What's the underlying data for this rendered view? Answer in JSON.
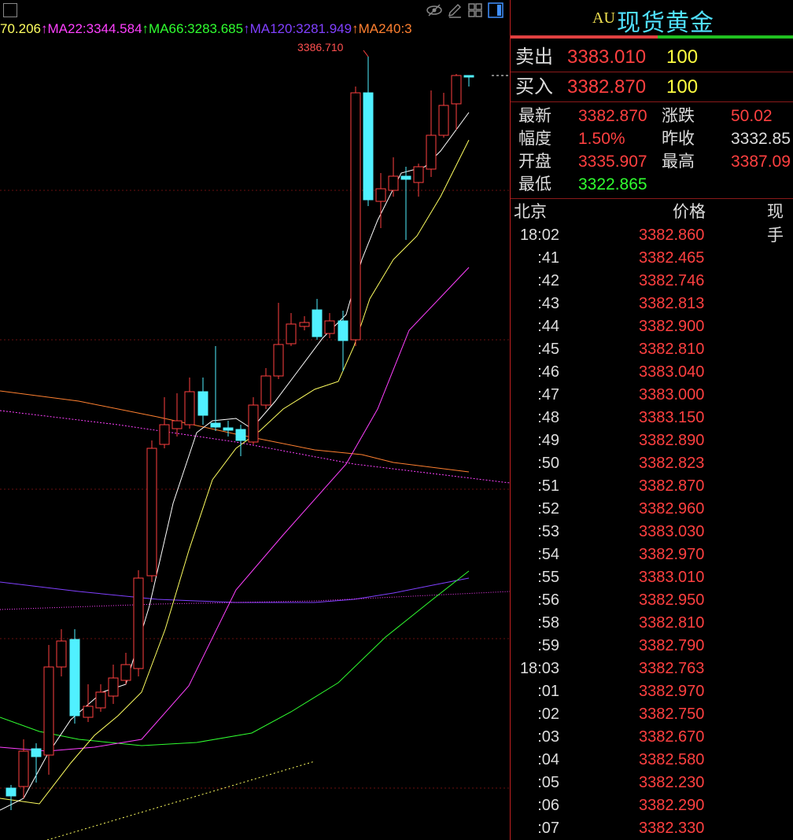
{
  "chart": {
    "high_marker": "3386.710",
    "ma_legend": [
      {
        "text": "70.206",
        "color": "#ffff60"
      },
      {
        "text": "↑MA22:3344.584",
        "color": "#ff40ff"
      },
      {
        "text": "↑MA66:3283.685",
        "color": "#30ff30"
      },
      {
        "text": "↑MA120:3281.949",
        "color": "#8040ff"
      },
      {
        "text": "↑MA240:3",
        "color": "#ff8030"
      }
    ],
    "toolbar": [
      "eye-icon",
      "pencil-icon",
      "grid-icon",
      "panel-icon"
    ]
  },
  "quote": {
    "prefix": "AU",
    "title": "现货黄金",
    "colors": {
      "up": "#ff4040",
      "down": "#30ff30",
      "neutral": "#dddddd",
      "volume": "#ffff40",
      "title": "#50e0ff"
    },
    "ask": {
      "label": "卖出",
      "price": "3383.010",
      "qty": "100"
    },
    "bid": {
      "label": "买入",
      "price": "3382.870",
      "qty": "100"
    },
    "stats": [
      {
        "l1": "最新",
        "v1": "3382.870",
        "c1": "#ff4040",
        "l2": "涨跌",
        "v2": "50.02",
        "c2": "#ff4040"
      },
      {
        "l1": "幅度",
        "v1": "1.50%",
        "c1": "#ff4040",
        "l2": "昨收",
        "v2": "3332.85",
        "c2": "#dddddd"
      },
      {
        "l1": "开盘",
        "v1": "3335.907",
        "c1": "#ff4040",
        "l2": "最高",
        "v2": "3387.09",
        "c2": "#ff4040"
      },
      {
        "l1": "最低",
        "v1": "3322.865",
        "c1": "#30ff30",
        "l2": "",
        "v2": "",
        "c2": "#dddddd"
      }
    ],
    "tick_header": {
      "time": "北京",
      "price": "价格",
      "volume": "现手"
    },
    "ticks": [
      {
        "time": "18:02",
        "price": "3382.860"
      },
      {
        "time": ":41",
        "price": "3382.465"
      },
      {
        "time": ":42",
        "price": "3382.746"
      },
      {
        "time": ":43",
        "price": "3382.813"
      },
      {
        "time": ":44",
        "price": "3382.900"
      },
      {
        "time": ":45",
        "price": "3382.810"
      },
      {
        "time": ":46",
        "price": "3383.040"
      },
      {
        "time": ":47",
        "price": "3383.000"
      },
      {
        "time": ":48",
        "price": "3383.150"
      },
      {
        "time": ":49",
        "price": "3382.890"
      },
      {
        "time": ":50",
        "price": "3382.823"
      },
      {
        "time": ":51",
        "price": "3382.870"
      },
      {
        "time": ":52",
        "price": "3382.960"
      },
      {
        "time": ":53",
        "price": "3383.030"
      },
      {
        "time": ":54",
        "price": "3382.970"
      },
      {
        "time": ":55",
        "price": "3383.010"
      },
      {
        "time": ":56",
        "price": "3382.950"
      },
      {
        "time": ":58",
        "price": "3382.810"
      },
      {
        "time": ":59",
        "price": "3382.790"
      },
      {
        "time": "18:03",
        "price": "3382.763"
      },
      {
        "time": ":01",
        "price": "3382.970"
      },
      {
        "time": ":02",
        "price": "3382.750"
      },
      {
        "time": ":03",
        "price": "3382.670"
      },
      {
        "time": ":04",
        "price": "3382.580"
      },
      {
        "time": ":05",
        "price": "3382.230"
      },
      {
        "time": ":06",
        "price": "3382.290"
      },
      {
        "time": ":07",
        "price": "3382.330"
      }
    ]
  }
}
